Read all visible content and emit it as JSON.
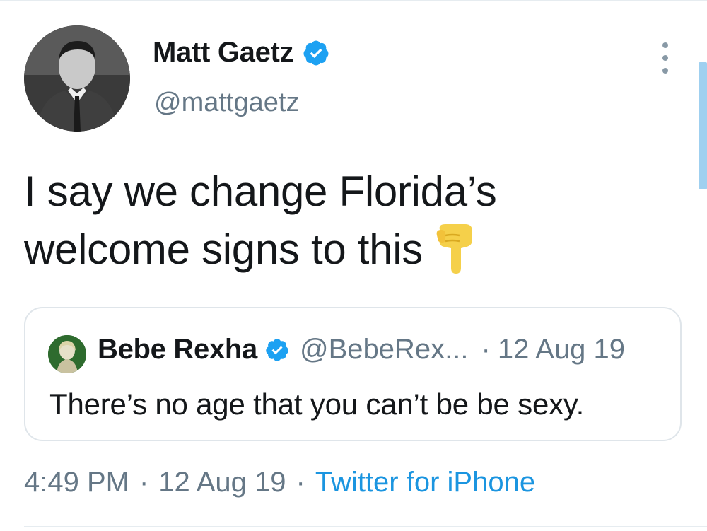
{
  "tweet": {
    "author": {
      "name": "Matt Gaetz",
      "handle": "@mattgaetz",
      "verified": true,
      "avatar_icon": "profile-photo"
    },
    "text_line1": "I say we change Florida’s",
    "text_line2": "welcome signs to this",
    "emoji": "backhand-index-pointing-down",
    "quoted_tweet": {
      "author_name": "Bebe Rexha",
      "author_handle": "@BebeRex...",
      "separator": "·",
      "date": "12 Aug 19",
      "verified": true,
      "text": "There’s no age that you can’t be be sexy."
    },
    "meta": {
      "time": "4:49 PM",
      "separator": "·",
      "date": "12 Aug 19",
      "source": "Twitter for iPhone"
    },
    "more_icon": "more-vertical-icon"
  },
  "colors": {
    "text": "#14171a",
    "secondary": "#657786",
    "accent": "#1b95e0",
    "verified": "#1da1f2",
    "border": "#dfe5ea"
  }
}
